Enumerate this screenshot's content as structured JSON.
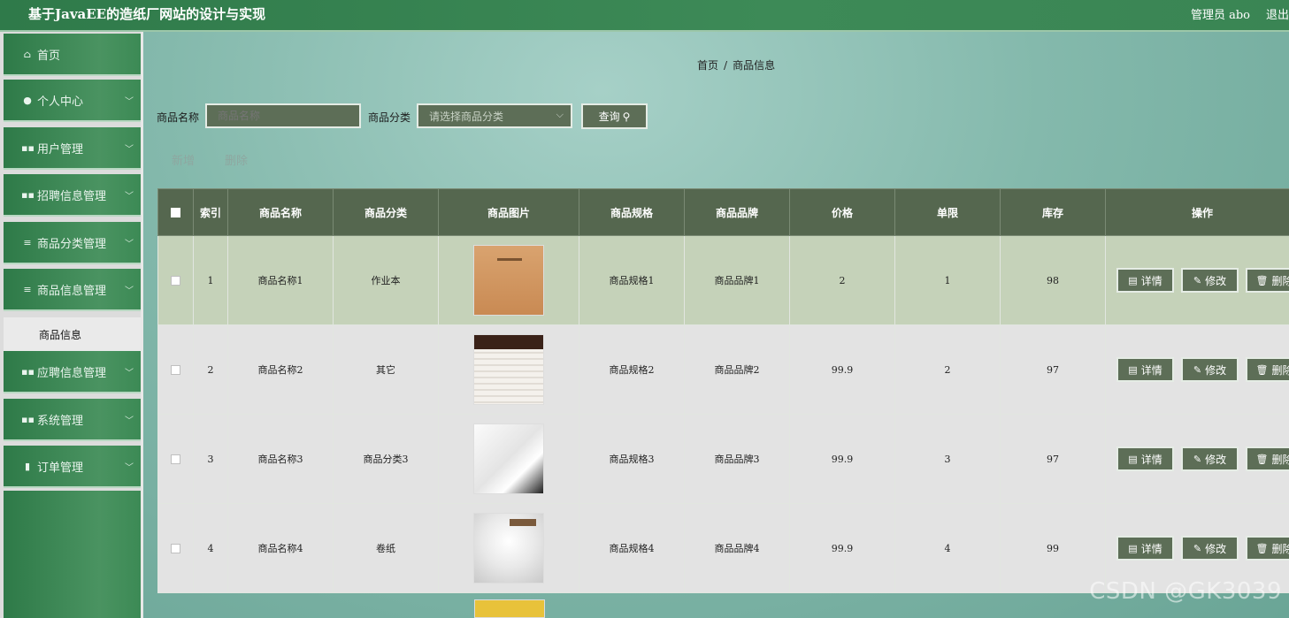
{
  "header": {
    "title": "基于JavaEE的造纸厂网站的设计与实现",
    "user_label": "管理员 abo",
    "logout_label": "退出"
  },
  "sidebar": {
    "items": [
      {
        "label": "首页",
        "icon": "home-icon",
        "glyph": "⌂",
        "expandable": false
      },
      {
        "label": "个人中心",
        "icon": "person-icon",
        "glyph": "●",
        "expandable": true
      },
      {
        "label": "用户管理",
        "icon": "grid-icon",
        "glyph": "▪▪",
        "expandable": true
      },
      {
        "label": "招聘信息管理",
        "icon": "grid-icon",
        "glyph": "▪▪",
        "expandable": true
      },
      {
        "label": "商品分类管理",
        "icon": "list-icon",
        "glyph": "≡",
        "expandable": true
      },
      {
        "label": "商品信息管理",
        "icon": "list-icon",
        "glyph": "≡",
        "expandable": true
      },
      {
        "label": "应聘信息管理",
        "icon": "grid-icon",
        "glyph": "▪▪",
        "expandable": true
      },
      {
        "label": "系统管理",
        "icon": "grid-icon",
        "glyph": "▪▪",
        "expandable": true
      },
      {
        "label": "订单管理",
        "icon": "trash-icon",
        "glyph": "▮",
        "expandable": true
      }
    ],
    "active_subitem": "商品信息"
  },
  "breadcrumb": {
    "home": "首页",
    "separator": "/",
    "current": "商品信息"
  },
  "search": {
    "name_label": "商品名称",
    "name_placeholder": "商品名称",
    "category_label": "商品分类",
    "category_placeholder": "请选择商品分类",
    "query_label": "查询"
  },
  "actions": {
    "add_label": "新增",
    "delete_label": "删除"
  },
  "table": {
    "columns": [
      "",
      "索引",
      "商品名称",
      "商品分类",
      "商品图片",
      "商品规格",
      "商品品牌",
      "价格",
      "单限",
      "库存",
      "操作"
    ],
    "rows": [
      {
        "index": "1",
        "name": "商品名称1",
        "category": "作业本",
        "spec": "商品规格1",
        "brand": "商品品牌1",
        "price": "2",
        "limit": "1",
        "stock": "98"
      },
      {
        "index": "2",
        "name": "商品名称2",
        "category": "其它",
        "spec": "商品规格2",
        "brand": "商品品牌2",
        "price": "99.9",
        "limit": "2",
        "stock": "97"
      },
      {
        "index": "3",
        "name": "商品名称3",
        "category": "商品分类3",
        "spec": "商品规格3",
        "brand": "商品品牌3",
        "price": "99.9",
        "limit": "3",
        "stock": "97"
      },
      {
        "index": "4",
        "name": "商品名称4",
        "category": "卷纸",
        "spec": "商品规格4",
        "brand": "商品品牌4",
        "price": "99.9",
        "limit": "4",
        "stock": "99"
      }
    ],
    "row_actions": {
      "detail_label": "详情",
      "edit_label": "修改",
      "delete_label": "删除"
    }
  },
  "watermark": "CSDN @GK3039",
  "colors": {
    "header_green": "#2f7a4a",
    "sidebar_green": "#4a9361",
    "control_dark": "#5d6e57",
    "table_header": "#55674f",
    "row_highlight": "#c5d2b9"
  }
}
